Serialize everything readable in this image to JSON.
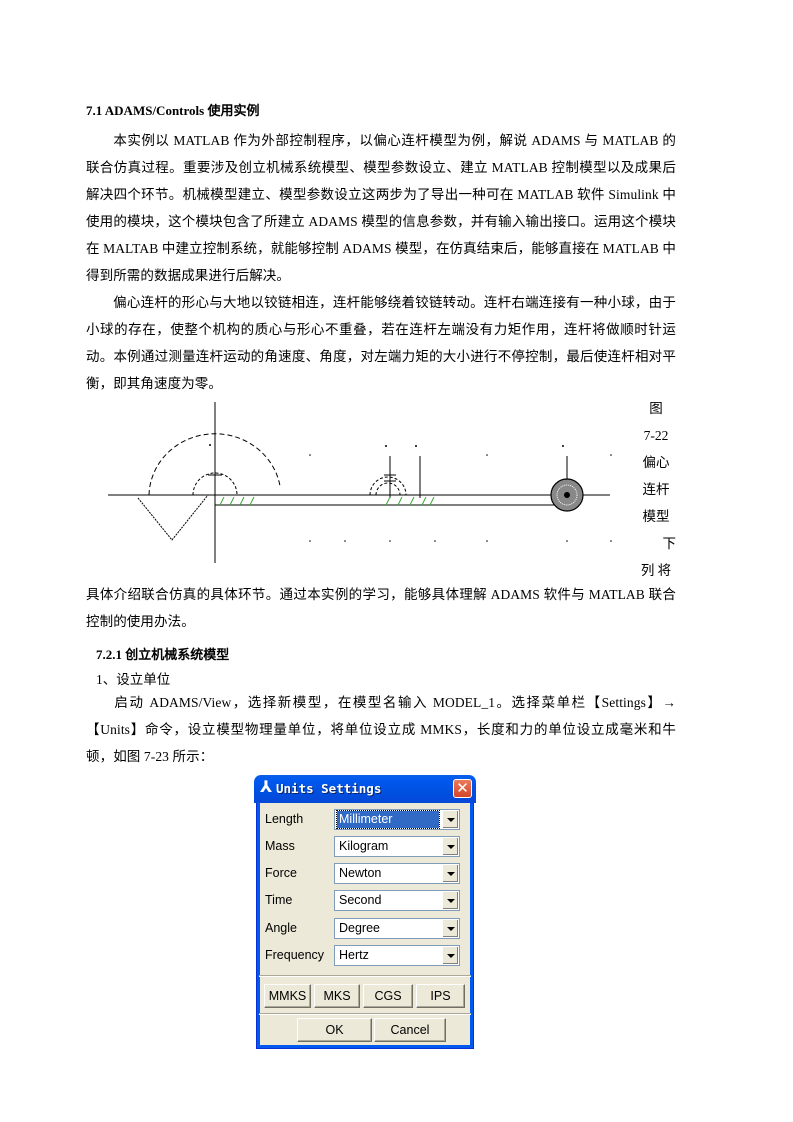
{
  "section": {
    "heading": "7.1  ADAMS/Controls 使用实例",
    "para1": "本实例以 MATLAB 作为外部控制程序，以偏心连杆模型为例，解说 ADAMS 与 MATLAB 的联合仿真过程。重要涉及创立机械系统模型、模型参数设立、建立 MATLAB 控制模型以及成果后解决四个环节。机械模型建立、模型参数设立这两步为了导出一种可在 MATLAB 软件 Simulink 中使用的模块，这个模块包含了所建立 ADAMS 模型的信息参数，并有输入输出接口。运用这个模块在 MALTAB 中建立控制系统，就能够控制 ADAMS 模型，在仿真结束后，能够直接在 MATLAB 中得到所需的数据成果进行后解决。",
    "para2": "偏心连杆的形心与大地以铰链相连，连杆能够绕着铰链转动。连杆右端连接有一种小球，由于小球的存在，使整个机构的质心与形心不重叠，若在连杆左端没有力矩作用，连杆将做顺时针运动。本例通过测量连杆运动的角速度、角度，对左端力矩的大小进行不停控制，最后使连杆相对平衡，即其角速度为零。",
    "figure_caption_lines": [
      "图",
      "7-22",
      "偏心",
      "连杆",
      "模型",
      "下",
      "列  将"
    ],
    "para3": "具体介绍联合仿真的具体环节。通过本实例的学习，能够具体理解 ADAMS 软件与 MATLAB 联合控制的使用办法。"
  },
  "subsection": {
    "heading": "7.2.1  创立机械系统模型",
    "step": "1、设立单位",
    "para": "启动 ADAMS/View，选择新模型，在模型名输入 MODEL_1。选择菜单栏【Settings】→【Units】命令，设立模型物理量单位，将单位设立成 MMKS，长度和力的单位设立成毫米和牛顿，如图 7-23 所示："
  },
  "dialog": {
    "title": "Units Settings",
    "title_icon": "adams-icon",
    "close_glyph": "✕",
    "rows": [
      {
        "label": "Length",
        "value": "Millimeter",
        "selected": true
      },
      {
        "label": "Mass",
        "value": "Kilogram"
      },
      {
        "label": "Force",
        "value": "Newton"
      },
      {
        "label": "Time",
        "value": "Second"
      },
      {
        "label": "Angle",
        "value": "Degree"
      },
      {
        "label": "Frequency",
        "value": "Hertz"
      }
    ],
    "preset_buttons": [
      "MMKS",
      "MKS",
      "CGS",
      "IPS"
    ],
    "ok_label": "OK",
    "cancel_label": "Cancel"
  }
}
